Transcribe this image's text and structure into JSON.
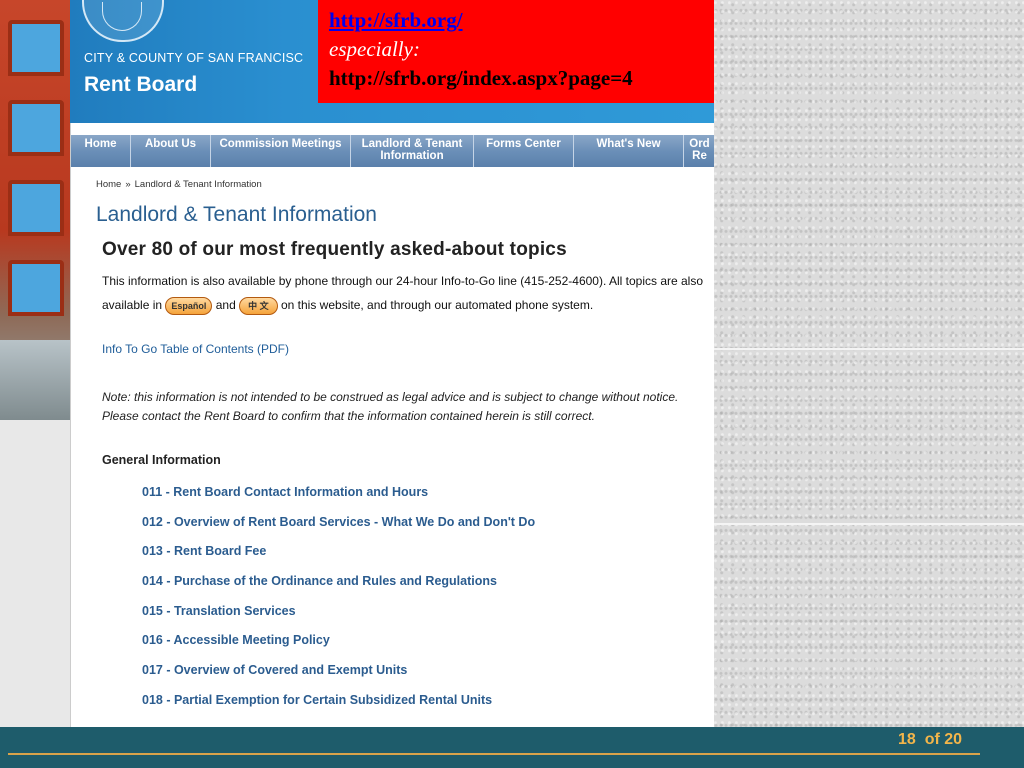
{
  "header": {
    "city": "CITY & COUNTY OF SAN FRANCISC",
    "title": "Rent Board"
  },
  "annotation": {
    "url1": "http://sfrb.org/",
    "especially": "especially:",
    "url2": "http://sfrb.org/index.aspx?page=4"
  },
  "nav": [
    {
      "label": "Home"
    },
    {
      "label": "About Us"
    },
    {
      "label": "Commission Meetings"
    },
    {
      "label": "Landlord & Tenant\nInformation"
    },
    {
      "label": "Forms Center"
    },
    {
      "label": "What's New"
    },
    {
      "label": "Ord\nRe"
    }
  ],
  "breadcrumb": {
    "home": "Home",
    "sep": "»",
    "current": "Landlord & Tenant Information"
  },
  "page": {
    "title": "Landlord & Tenant Information",
    "subtitle": "Over 80 of our most frequently asked-about topics",
    "intro_a": "This information is also available by phone through our 24-hour Info-to-Go line (415-252-4600).  All topics are also available in",
    "espanol": "Español",
    "and": "and",
    "chinese": "中 文",
    "intro_b": "on this website, and through our automated phone system.",
    "toc_link": "Info To Go Table of Contents (PDF)",
    "note": "Note: this information is not intended to be construed as legal advice and is subject to change without notice. Please contact the Rent Board to confirm that the information contained herein is still correct.",
    "section": "General Information",
    "links": [
      "011 - Rent Board Contact Information and Hours",
      "012 - Overview of Rent Board Services - What We Do and Don't Do",
      "013 - Rent Board Fee",
      "014 - Purchase of the Ordinance and Rules and Regulations",
      "015 - Translation Services",
      "016 - Accessible Meeting Policy",
      "017 - Overview of Covered and Exempt Units",
      "018 - Partial Exemption for Certain Subsidized Rental Units"
    ]
  },
  "footer": {
    "page_number": "18",
    "of": "of",
    "total": "20"
  }
}
